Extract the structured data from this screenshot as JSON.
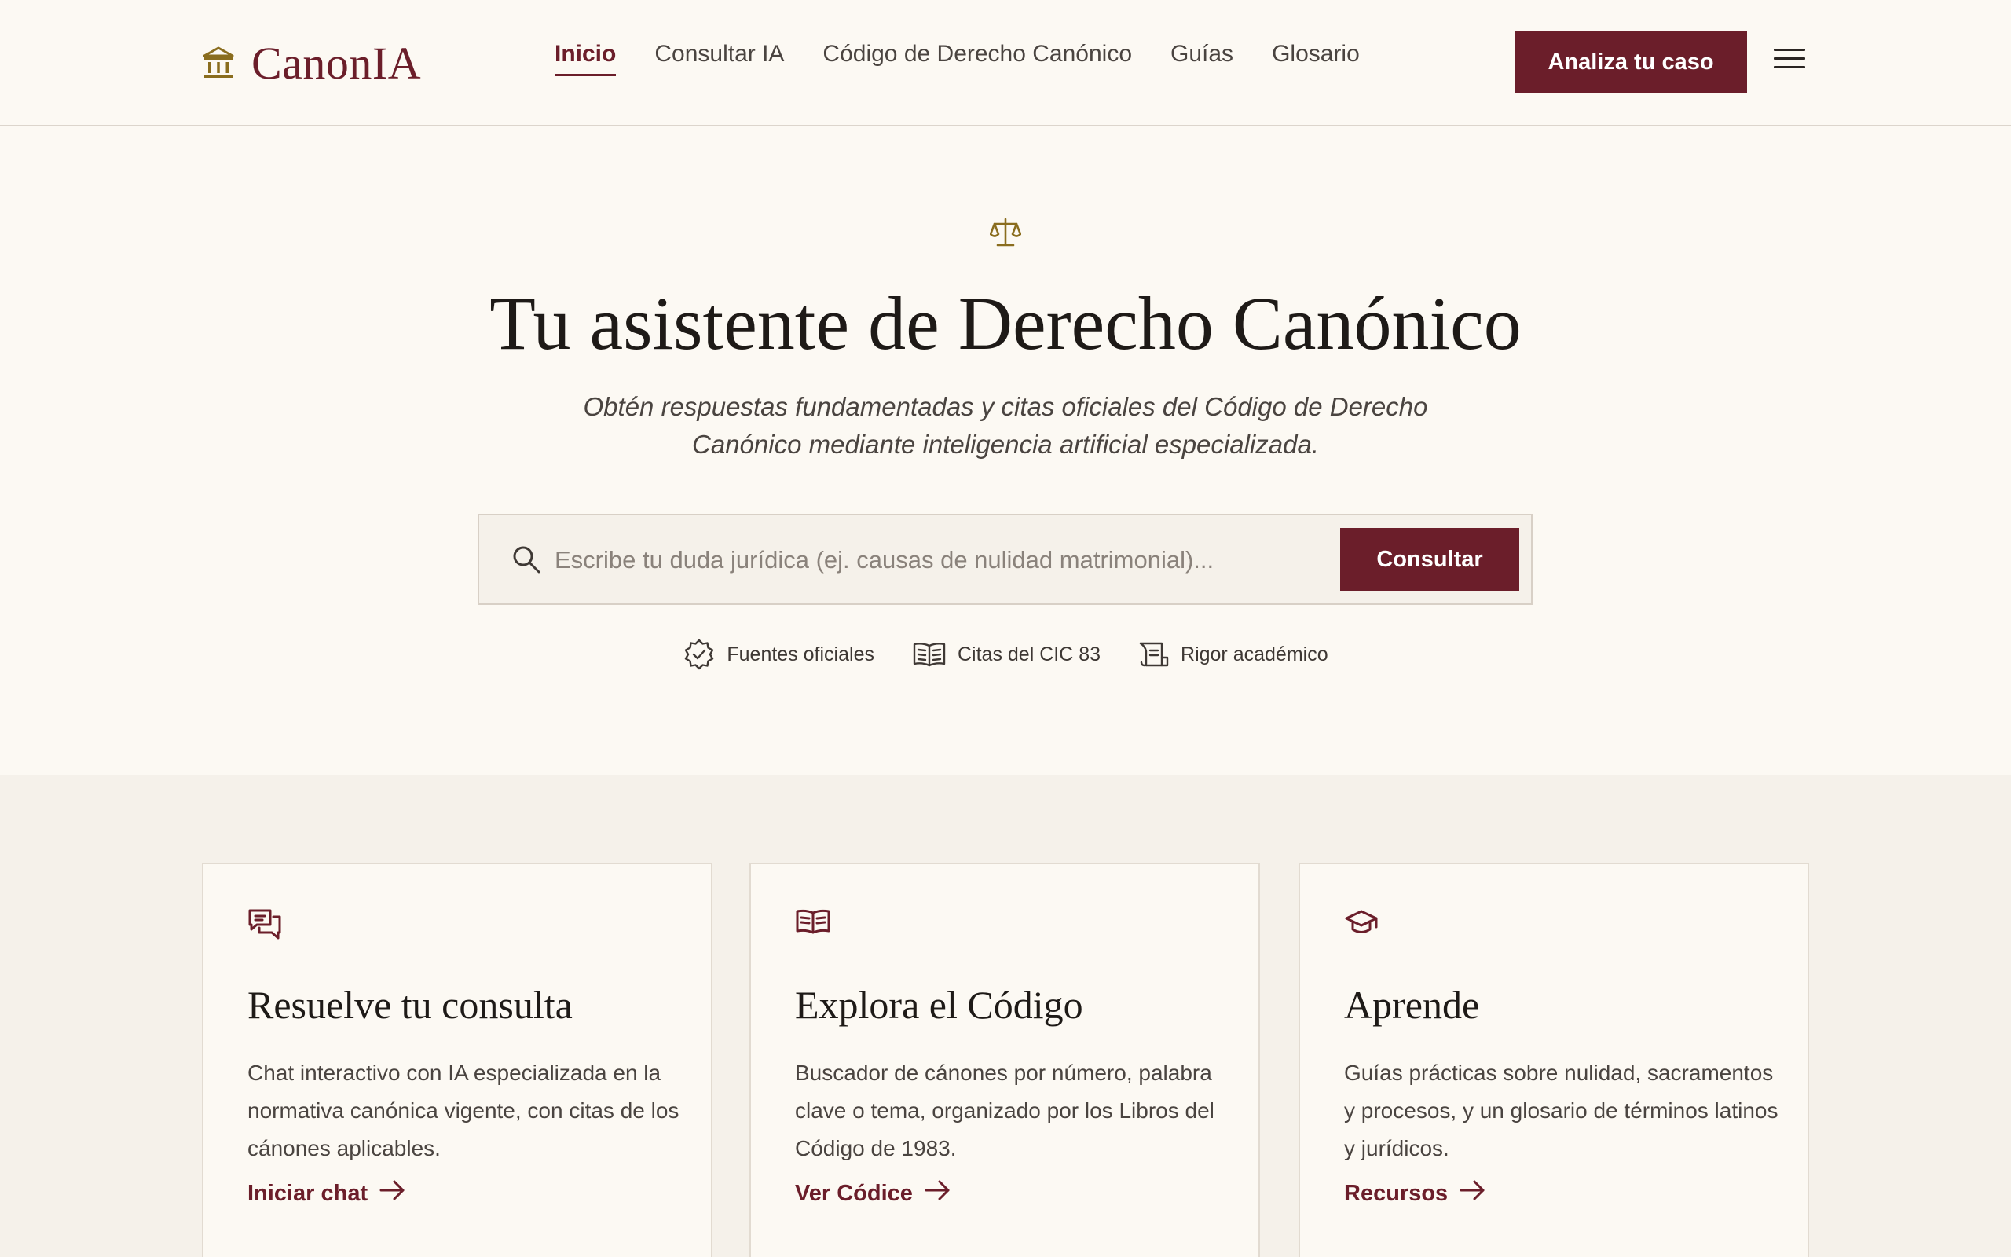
{
  "colors": {
    "accent": "#6b1e2a",
    "gold": "#8a6d1e",
    "background": "#fcf9f3",
    "section_bg": "#f5f1ea"
  },
  "header": {
    "brand": "CanonIA",
    "brand_icon": "institution-icon",
    "nav": [
      {
        "label": "Inicio",
        "active": true
      },
      {
        "label": "Consultar IA",
        "active": false
      },
      {
        "label": "Código de Derecho Canónico",
        "active": false
      },
      {
        "label": "Guías",
        "active": false
      },
      {
        "label": "Glosario",
        "active": false
      }
    ],
    "cta_label": "Analiza tu caso",
    "menu_icon": "hamburger-menu-icon"
  },
  "hero": {
    "icon": "scales-icon",
    "title": "Tu asistente de Derecho Canónico",
    "subtitle": "Obtén respuestas fundamentadas y citas oficiales del Código de Derecho Canónico mediante inteligencia artificial especializada.",
    "search": {
      "placeholder": "Escribe tu duda jurídica (ej. causas de nulidad matrimonial)...",
      "value": "",
      "button_label": "Consultar"
    },
    "badges": [
      {
        "icon": "verified-badge-icon",
        "label": "Fuentes oficiales"
      },
      {
        "icon": "open-book-icon",
        "label": "Citas del CIC 83"
      },
      {
        "icon": "scroll-icon",
        "label": "Rigor académico"
      }
    ]
  },
  "features": [
    {
      "icon": "chat-icon",
      "title": "Resuelve tu consulta",
      "description": "Chat interactivo con IA especializada en la normativa canónica vigente, con citas de los cánones aplicables.",
      "link": "Iniciar chat"
    },
    {
      "icon": "book-icon",
      "title": "Explora el Código",
      "description": "Buscador de cánones por número, palabra clave o tema, organizado por los Libros del Código de 1983.",
      "link": "Ver Códice"
    },
    {
      "icon": "graduation-cap-icon",
      "title": "Aprende",
      "description": "Guías prácticas sobre nulidad, sacramentos y procesos, y un glosario de términos latinos y jurídicos.",
      "link": "Recursos"
    }
  ]
}
